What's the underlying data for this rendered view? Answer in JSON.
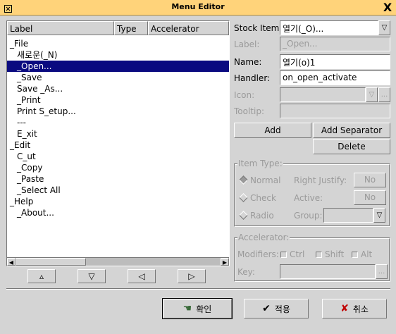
{
  "window": {
    "title": "Menu Editor",
    "close_glyph": "X"
  },
  "tree": {
    "columns": [
      "Label",
      "Type",
      "Accelerator"
    ],
    "rows": [
      {
        "label": "_File",
        "indent": 0,
        "selected": false
      },
      {
        "label": "새로운(_N)",
        "indent": 1,
        "selected": false
      },
      {
        "label": "_Open...",
        "indent": 1,
        "selected": true
      },
      {
        "label": "_Save",
        "indent": 1,
        "selected": false
      },
      {
        "label": "Save _As...",
        "indent": 1,
        "selected": false
      },
      {
        "label": "_Print",
        "indent": 1,
        "selected": false
      },
      {
        "label": "Print S_etup...",
        "indent": 1,
        "selected": false
      },
      {
        "label": "---",
        "indent": 1,
        "selected": false
      },
      {
        "label": "E_xit",
        "indent": 1,
        "selected": false
      },
      {
        "label": "_Edit",
        "indent": 0,
        "selected": false
      },
      {
        "label": "C_ut",
        "indent": 1,
        "selected": false
      },
      {
        "label": "_Copy",
        "indent": 1,
        "selected": false
      },
      {
        "label": "_Paste",
        "indent": 1,
        "selected": false
      },
      {
        "label": "_Select All",
        "indent": 1,
        "selected": false
      },
      {
        "label": "_Help",
        "indent": 0,
        "selected": false
      },
      {
        "label": "_About...",
        "indent": 1,
        "selected": false
      }
    ]
  },
  "move_buttons": {
    "up": "▵",
    "down": "▽",
    "left": "◁",
    "right": "▷"
  },
  "form": {
    "stock_item_label": "Stock Item:",
    "stock_item_value": "열기(_O)...",
    "label_label": "Label:",
    "label_value": "_Open...",
    "name_label": "Name:",
    "name_value": "열기(o)1",
    "handler_label": "Handler:",
    "handler_value": "on_open_activate",
    "icon_label": "Icon:",
    "icon_value": "",
    "icon_browse": "...",
    "tooltip_label": "Tooltip:",
    "tooltip_value": ""
  },
  "actions": {
    "add": "Add",
    "add_separator": "Add Separator",
    "delete": "Delete"
  },
  "item_type": {
    "title": "Item Type:",
    "normal": "Normal",
    "check": "Check",
    "radio": "Radio",
    "selected": "Normal",
    "right_justify_label": "Right Justify:",
    "right_justify_value": "No",
    "active_label": "Active:",
    "active_value": "No",
    "group_label": "Group:"
  },
  "accelerator": {
    "title": "Accelerator:",
    "modifiers_label": "Modifiers:",
    "ctrl": "Ctrl",
    "shift": "Shift",
    "alt": "Alt",
    "key_label": "Key:",
    "key_browse": "..."
  },
  "dialog_buttons": {
    "ok": "확인",
    "apply": "적용",
    "cancel": "취소"
  },
  "colors": {
    "selection": "#0a0a80",
    "titlebar": "#ffd37a",
    "cancel_icon": "#c00000",
    "apply_icon": "#000000",
    "ok_icon": "#3a6a3a"
  }
}
